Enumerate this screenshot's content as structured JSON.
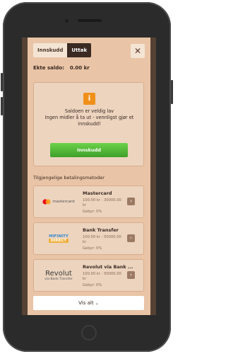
{
  "tabs": {
    "deposit": "Innskudd",
    "withdraw": "Uttak"
  },
  "close_label": "✕",
  "balance": {
    "label": "Ekte saldo:",
    "value": "0.00 kr"
  },
  "notice": {
    "icon": "i",
    "line1": "Saldoen er veldig lav",
    "line2": "Ingen midler å ta ut - vennligst gjør et innskudd!",
    "button": "Innskudd"
  },
  "methods_title": "Tilgjengelige betalingsmetoder",
  "methods": [
    {
      "name": "Mastercard",
      "range": "100.00 kr - 30000.00 kr",
      "fee": "Gebyr: 0%",
      "logo_text": "mastercard"
    },
    {
      "name": "Bank Transfer",
      "range": "100.00 kr - 50000.00 kr",
      "fee": "Gebyr: 0%",
      "logo_text_1": "MIFINITY",
      "logo_text_2": "DIRECT"
    },
    {
      "name": "Revolut via Bank ...",
      "range": "100.00 kr - 50000.00 kr",
      "fee": "Gebyr: 0%",
      "logo_text_1": "Revolut",
      "logo_text_2": "via Bank Transfer"
    }
  ],
  "see_all": "Vis alt",
  "colors": {
    "accent_green": "#4fb233",
    "info_orange": "#f0901b",
    "panel": "#e9c4a6"
  }
}
